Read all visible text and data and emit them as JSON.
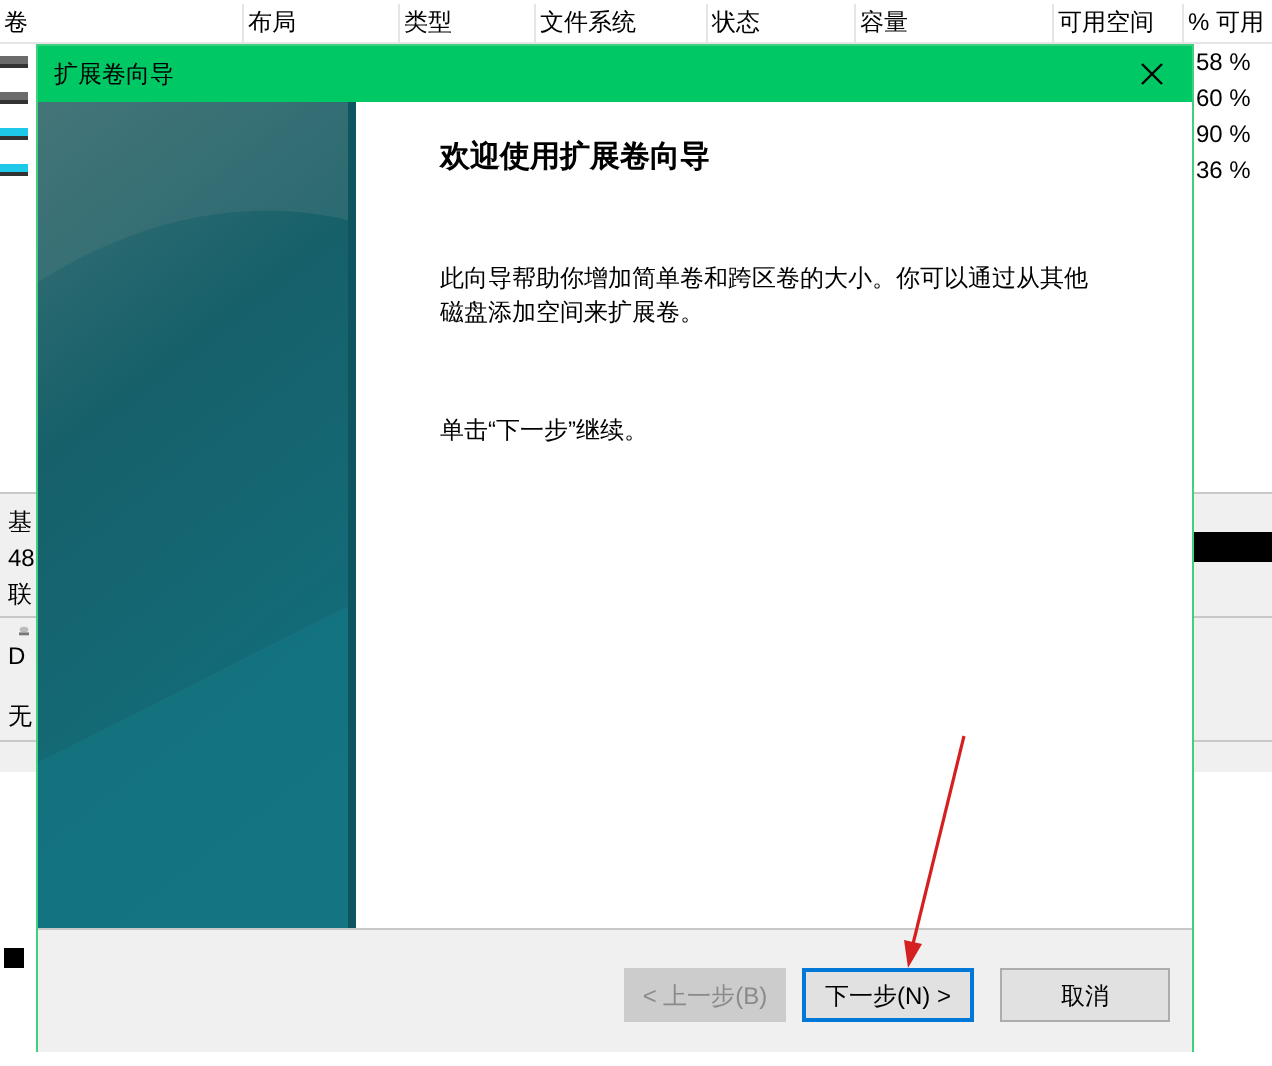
{
  "background_window": {
    "columns": [
      "卷",
      "布局",
      "类型",
      "文件系统",
      "状态",
      "容量",
      "可用空间",
      "% 可用"
    ],
    "rows": [
      {
        "percent_free": "58 %",
        "kind": "system"
      },
      {
        "percent_free": "60 %",
        "kind": "system"
      },
      {
        "percent_free": "90 %",
        "kind": "new"
      },
      {
        "percent_free": "36 %",
        "kind": "new"
      }
    ],
    "disks": [
      {
        "kind": "disk",
        "lines": [
          "基",
          "48",
          "联"
        ]
      },
      {
        "kind": "dvd",
        "lines": [
          "D",
          "无"
        ]
      }
    ]
  },
  "dialog": {
    "title": "扩展卷向导",
    "heading": "欢迎使用扩展卷向导",
    "description": "此向导帮助你增加简单卷和跨区卷的大小。你可以通过从其他磁盘添加空间来扩展卷。",
    "instruction": "单击“下一步”继续。",
    "buttons": [
      {
        "label": "< 上一步(B)",
        "disabled": true,
        "selected": false
      },
      {
        "label": "下一步(N) >",
        "disabled": false,
        "selected": true
      },
      {
        "label": "取消",
        "disabled": false,
        "selected": false
      }
    ]
  }
}
